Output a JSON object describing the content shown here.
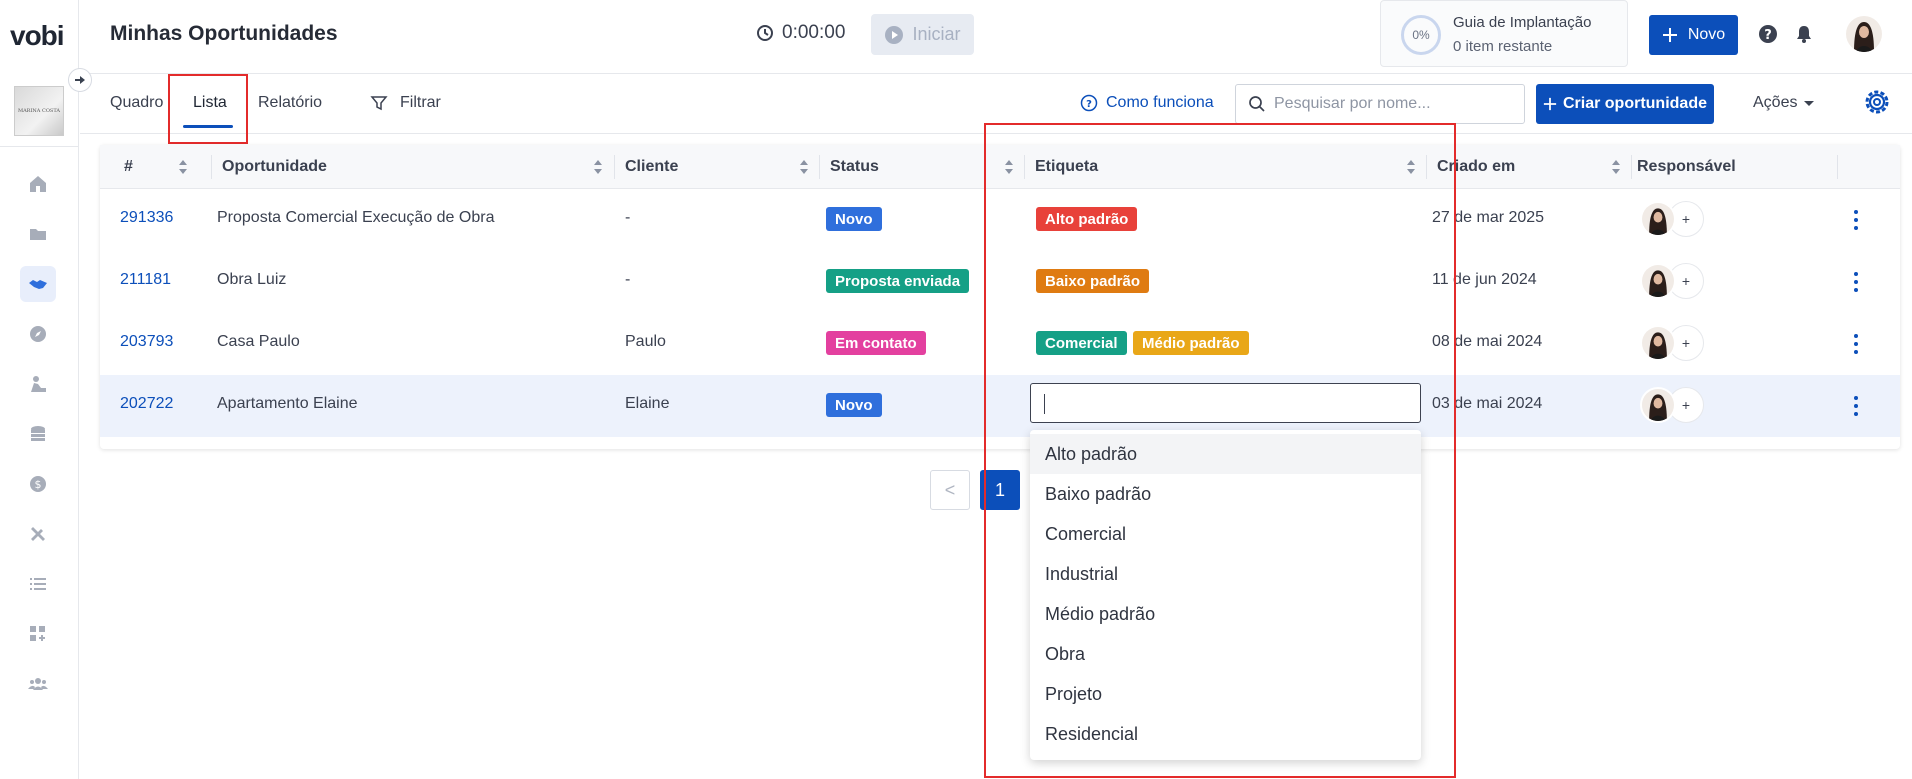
{
  "app": {
    "logo": "vobi",
    "company_thumb_text": "MARINA COSTA"
  },
  "header": {
    "title": "Minhas Oportunidades",
    "timer": "0:00:00",
    "start_label": "Iniciar",
    "guide": {
      "percent": "0%",
      "title": "Guia de Implantação",
      "subtitle": "0 item restante"
    },
    "new_label": "Novo"
  },
  "tabs": [
    "Quadro",
    "Lista",
    "Relatório"
  ],
  "active_tab": "Lista",
  "toolbar": {
    "filter_label": "Filtrar",
    "howto_label": "Como funciona",
    "search_placeholder": "Pesquisar por nome...",
    "create_label": "Criar oportunidade",
    "actions_label": "Ações"
  },
  "table": {
    "columns": [
      "#",
      "Oportunidade",
      "Cliente",
      "Status",
      "Etiqueta",
      "Criado em",
      "Responsável"
    ],
    "rows": [
      {
        "id": "291336",
        "name": "Proposta Comercial Execução de Obra",
        "client": "-",
        "status": "Novo",
        "status_color": "#2f6fdc",
        "tags": [
          {
            "label": "Alto padrão",
            "color": "#e8413a"
          }
        ],
        "created": "27 de mar 2025"
      },
      {
        "id": "211181",
        "name": "Obra Luiz",
        "client": "-",
        "status": "Proposta enviada",
        "status_color": "#15a086",
        "tags": [
          {
            "label": "Baixo padrão",
            "color": "#df7b12"
          }
        ],
        "created": "11 de jun 2024"
      },
      {
        "id": "203793",
        "name": "Casa Paulo",
        "client": "Paulo",
        "status": "Em contato",
        "status_color": "#e3409f",
        "tags": [
          {
            "label": "Comercial",
            "color": "#15a086"
          },
          {
            "label": "Médio padrão",
            "color": "#e9a718"
          }
        ],
        "created": "08 de mai 2024"
      },
      {
        "id": "202722",
        "name": "Apartamento Elaine",
        "client": "Elaine",
        "status": "Novo",
        "status_color": "#2f6fdc",
        "tags": [],
        "created": "03 de mai 2024"
      }
    ],
    "plus_label": "+"
  },
  "pagination": {
    "prev": "<",
    "current": "1"
  },
  "tag_options": [
    "Alto padrão",
    "Baixo padrão",
    "Comercial",
    "Industrial",
    "Médio padrão",
    "Obra",
    "Projeto",
    "Residencial"
  ],
  "colors": {
    "primary": "#0c4fba",
    "annotation": "#e32b2b"
  },
  "sidebar_icons": [
    "home-icon",
    "folder-icon",
    "handshake-icon",
    "compass-icon",
    "worker-icon",
    "coins-icon",
    "dollar-icon",
    "tools-icon",
    "list-icon",
    "apps-add-icon",
    "team-icon"
  ]
}
